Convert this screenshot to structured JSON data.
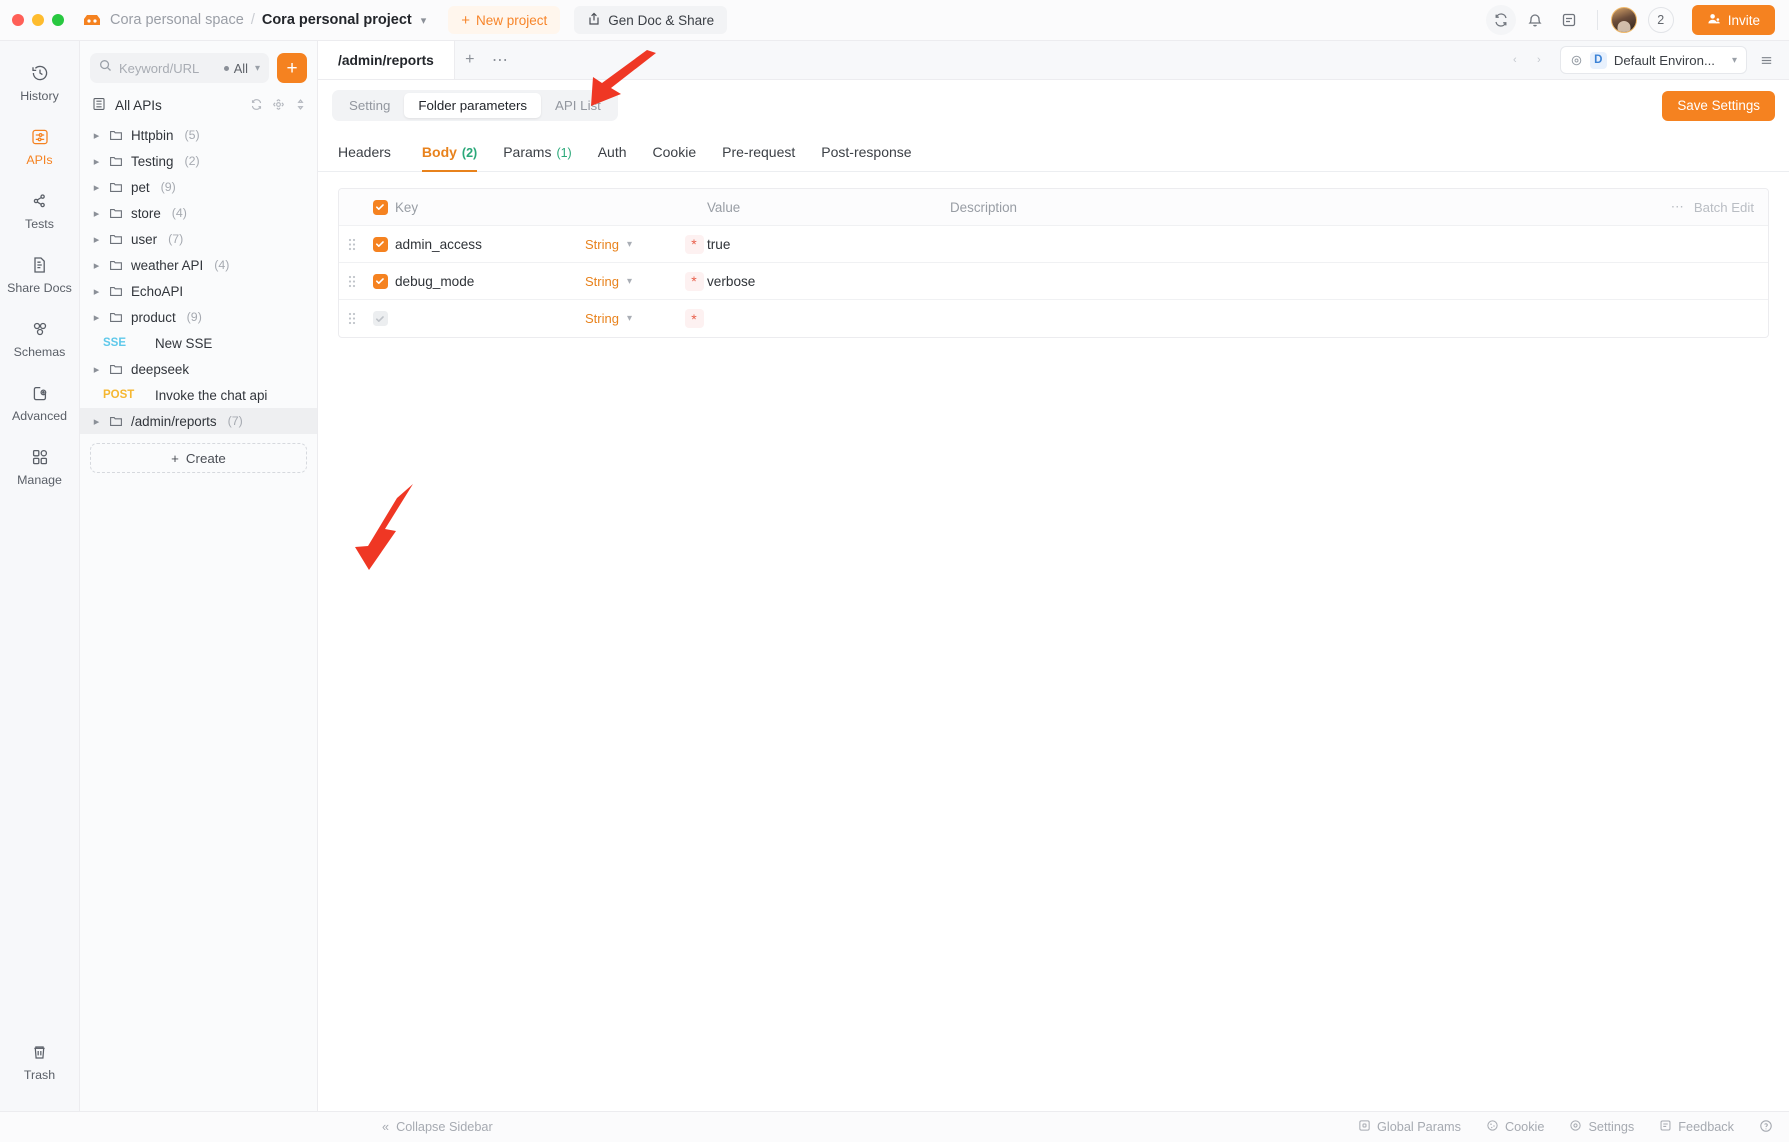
{
  "topbar": {
    "space": "Cora personal space",
    "separator": "/",
    "project": "Cora personal project",
    "new_project": "New project",
    "gen_doc": "Gen Doc & Share",
    "member_count": "2",
    "invite": "Invite"
  },
  "rail": {
    "items": [
      {
        "label": "History",
        "icon": "history-icon",
        "active": false
      },
      {
        "label": "APIs",
        "icon": "apis-icon",
        "active": true
      },
      {
        "label": "Tests",
        "icon": "tests-icon",
        "active": false
      },
      {
        "label": "Share Docs",
        "icon": "share-docs-icon",
        "active": false
      },
      {
        "label": "Schemas",
        "icon": "schemas-icon",
        "active": false
      },
      {
        "label": "Advanced",
        "icon": "advanced-icon",
        "active": false
      },
      {
        "label": "Manage",
        "icon": "manage-icon",
        "active": false
      }
    ],
    "trash": "Trash"
  },
  "sidebar": {
    "search_placeholder": "Keyword/URL",
    "filter_label": "All",
    "add_button": "+",
    "all_apis": "All APIs",
    "tree": [
      {
        "label": "Httpbin",
        "count": "(5)",
        "type": "folder",
        "selected": false
      },
      {
        "label": "Testing",
        "count": "(2)",
        "type": "folder",
        "selected": false
      },
      {
        "label": "pet",
        "count": "(9)",
        "type": "folder",
        "selected": false
      },
      {
        "label": "store",
        "count": "(4)",
        "type": "folder",
        "selected": false
      },
      {
        "label": "user",
        "count": "(7)",
        "type": "folder",
        "selected": false
      },
      {
        "label": "weather API",
        "count": "(4)",
        "type": "folder",
        "selected": false
      },
      {
        "label": "EchoAPI",
        "count": "",
        "type": "folder",
        "selected": false
      },
      {
        "label": "product",
        "count": "(9)",
        "type": "folder",
        "selected": false
      },
      {
        "label": "New SSE",
        "count": "",
        "type": "request",
        "method": "SSE",
        "selected": false
      },
      {
        "label": "deepseek",
        "count": "",
        "type": "folder",
        "selected": false
      },
      {
        "label": "Invoke the chat api",
        "count": "",
        "type": "request",
        "method": "POST",
        "selected": false
      },
      {
        "label": "/admin/reports",
        "count": "(7)",
        "type": "folder",
        "selected": true
      }
    ],
    "create": "Create"
  },
  "tabstrip": {
    "doc_tab": "/admin/reports",
    "add_tab": "+",
    "more": "⋯",
    "env_badge": "D",
    "env_name": "Default Environ...",
    "prev": "‹",
    "next": "›"
  },
  "segmented": {
    "items": [
      {
        "label": "Setting",
        "active": false
      },
      {
        "label": "Folder parameters",
        "active": true
      },
      {
        "label": "API List",
        "active": false
      }
    ],
    "save": "Save Settings"
  },
  "param_tabs": [
    {
      "label": "Headers",
      "count": "",
      "active": false
    },
    {
      "label": "Body",
      "count": "(2)",
      "active": true
    },
    {
      "label": "Params",
      "count": "(1)",
      "active": false
    },
    {
      "label": "Auth",
      "count": "",
      "active": false
    },
    {
      "label": "Cookie",
      "count": "",
      "active": false
    },
    {
      "label": "Pre-request",
      "count": "",
      "active": false
    },
    {
      "label": "Post-response",
      "count": "",
      "active": false
    }
  ],
  "table": {
    "headers": {
      "key": "Key",
      "value": "Value",
      "description": "Description",
      "batch_edit": "Batch Edit",
      "more": "⋯"
    },
    "rows": [
      {
        "checked": true,
        "key": "admin_access",
        "type": "String",
        "required": "*",
        "value": "true",
        "description": ""
      },
      {
        "checked": true,
        "key": "debug_mode",
        "type": "String",
        "required": "*",
        "value": "verbose",
        "description": ""
      },
      {
        "checked": false,
        "key": "",
        "type": "String",
        "required": "*",
        "value": "",
        "description": ""
      }
    ]
  },
  "statusbar": {
    "collapse": "Collapse Sidebar",
    "items": [
      {
        "label": "Global Params",
        "icon": "global-params-icon"
      },
      {
        "label": "Cookie",
        "icon": "cookie-icon"
      },
      {
        "label": "Settings",
        "icon": "settings-icon"
      },
      {
        "label": "Feedback",
        "icon": "feedback-icon"
      }
    ],
    "help": "?"
  },
  "colors": {
    "accent": "#f58220",
    "annotation": "#ef3724",
    "count_green": "#2aa879",
    "sse": "#5ec8ea",
    "post": "#f5b731"
  }
}
